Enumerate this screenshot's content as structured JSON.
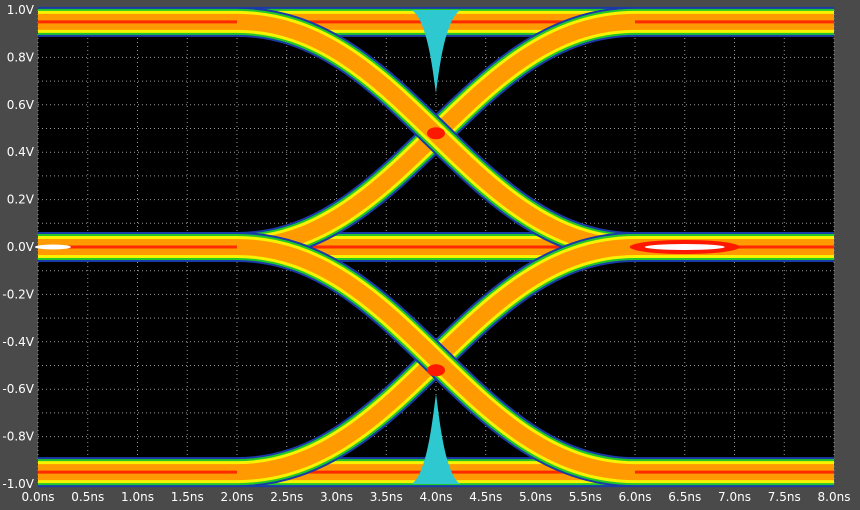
{
  "chart_data": {
    "type": "eye-diagram",
    "title": "",
    "xlabel": "",
    "ylabel": "",
    "x_unit": "ns",
    "y_unit": "V",
    "xlim": [
      0,
      8
    ],
    "ylim": [
      -1,
      1
    ],
    "x_ticks": [
      "0.0ns",
      "0.5ns",
      "1.0ns",
      "1.5ns",
      "2.0ns",
      "2.5ns",
      "3.0ns",
      "3.5ns",
      "4.0ns",
      "4.5ns",
      "5.0ns",
      "5.5ns",
      "6.0ns",
      "6.5ns",
      "7.0ns",
      "7.5ns",
      "8.0ns"
    ],
    "y_ticks": [
      "1.0V",
      "0.8V",
      "0.6V",
      "0.4V",
      "0.2V",
      "0.0V",
      "-0.2V",
      "-0.4V",
      "-0.6V",
      "-0.8V",
      "-1.0V"
    ],
    "grid": true,
    "levels_v": [
      0.95,
      0.0,
      -0.95
    ],
    "traces": [
      {
        "name": "upper-rising",
        "x": [
          2.0,
          4.0,
          6.0
        ],
        "y": [
          0.0,
          0.48,
          0.95
        ]
      },
      {
        "name": "upper-falling",
        "x": [
          2.0,
          4.0,
          6.0
        ],
        "y": [
          0.95,
          0.48,
          0.0
        ]
      },
      {
        "name": "lower-rising",
        "x": [
          2.0,
          4.0,
          6.0
        ],
        "y": [
          -0.95,
          -0.52,
          0.0
        ]
      },
      {
        "name": "lower-falling",
        "x": [
          2.0,
          4.0,
          6.0
        ],
        "y": [
          0.0,
          -0.52,
          -0.95
        ]
      }
    ],
    "crossings": [
      {
        "x": 4.0,
        "y": 0.48
      },
      {
        "x": 4.0,
        "y": -0.52
      },
      {
        "x": 6.5,
        "y": 0.0
      }
    ],
    "mask": {
      "center_x_ns": 4.0,
      "top": {
        "from_v": 1.0,
        "to_v": 0.65
      },
      "bottom": {
        "from_v": -1.0,
        "to_v": -0.62
      }
    },
    "colors": {
      "background": "#000000",
      "frame": "#4a4a4a",
      "grid": "#9a9a9a",
      "edge_blue": "#1a3aa8",
      "edge_green": "#23c828",
      "edge_yellow": "#f6f200",
      "core_orange": "#ff9a00",
      "hot_red": "#ff1800",
      "peak_white": "#ffffff",
      "mask": "#2ec8d0"
    }
  }
}
